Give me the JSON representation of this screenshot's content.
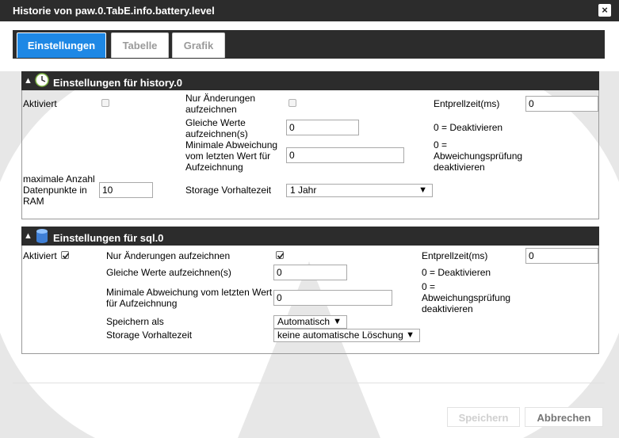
{
  "dialog": {
    "title": "Historie von paw.0.TabE.info.battery.level",
    "close_symbol": "×"
  },
  "tabs": [
    {
      "label": "Einstellungen",
      "active": true
    },
    {
      "label": "Tabelle",
      "active": false
    },
    {
      "label": "Grafik",
      "active": false
    }
  ],
  "history": {
    "header": "Einstellungen für history.0",
    "icon": "clock-icon",
    "enabled_label": "Aktiviert",
    "enabled": false,
    "changes_only_label_1": "Nur Änderungen",
    "changes_only_label_2": "aufzeichnen",
    "changes_only": false,
    "debounce_label": "Entprellzeit(ms)",
    "debounce_value": "0",
    "same_values_label_1": "Gleiche Werte",
    "same_values_label_2": "aufzeichnen(s)",
    "same_values_value": "0",
    "same_values_hint": "0 = Deaktivieren",
    "min_dev_label_1": "Minimale Abweichung",
    "min_dev_label_2": "vom letzten Wert für",
    "min_dev_label_3": "Aufzeichnung",
    "min_dev_value": "0",
    "min_dev_hint_1": "0 =",
    "min_dev_hint_2": "Abweichungsprüfung",
    "min_dev_hint_3": "deaktivieren",
    "max_points_label_1": "maximale Anzahl",
    "max_points_label_2": "Datenpunkte in",
    "max_points_label_3": "RAM",
    "max_points_value": "10",
    "retention_label": "Storage Vorhaltezeit",
    "retention_value": "1 Jahr"
  },
  "sql": {
    "header": "Einstellungen für sql.0",
    "icon": "database-icon",
    "enabled_label": "Aktiviert",
    "enabled": true,
    "changes_only_label": "Nur Änderungen aufzeichnen",
    "changes_only": true,
    "debounce_label": "Entprellzeit(ms)",
    "debounce_value": "0",
    "same_values_label": "Gleiche Werte aufzeichnen(s)",
    "same_values_value": "0",
    "same_values_hint": "0 = Deaktivieren",
    "min_dev_label_1": "Minimale Abweichung vom letzten Wert",
    "min_dev_label_2": "für Aufzeichnung",
    "min_dev_value": "0",
    "min_dev_hint_1": "0 =",
    "min_dev_hint_2": "Abweichungsprüfung",
    "min_dev_hint_3": "deaktivieren",
    "store_as_label": "Speichern als",
    "store_as_value": "Automatisch",
    "retention_label": "Storage Vorhaltezeit",
    "retention_value": "keine automatische Löschung"
  },
  "buttons": {
    "save": "Speichern",
    "cancel": "Abbrechen"
  },
  "colors": {
    "accent": "#1e88e5",
    "header_bg": "#2c2c2c"
  }
}
